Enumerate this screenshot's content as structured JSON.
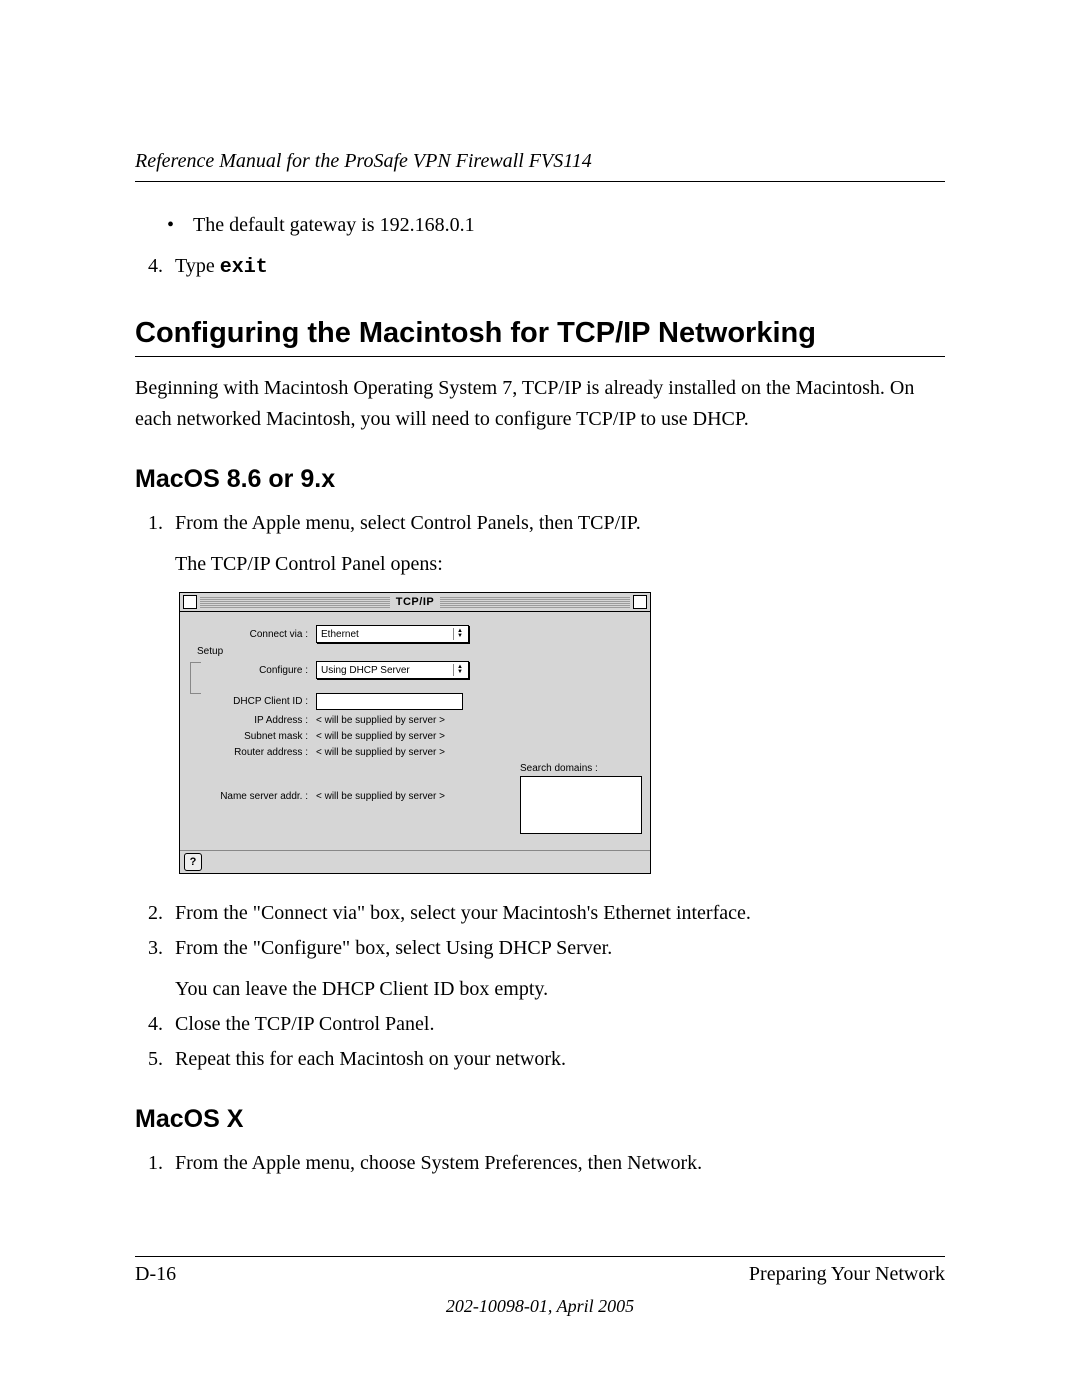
{
  "header": {
    "running_title": "Reference Manual for the ProSafe VPN Firewall FVS114"
  },
  "top_section": {
    "bullet_item": "The default gateway is 192.168.0.1",
    "step4_number": "4.",
    "step4_prefix": "Type ",
    "step4_command": "exit"
  },
  "section_heading": "Configuring the Macintosh for TCP/IP Networking",
  "intro_paragraph": "Beginning with Macintosh Operating System 7, TCP/IP is already installed on the Macintosh. On each networked Macintosh, you will need to configure TCP/IP to use DHCP.",
  "subsection_a": {
    "heading": "MacOS 8.6 or 9.x",
    "steps": {
      "s1_num": "1.",
      "s1_a": "From the Apple menu, select Control Panels, then TCP/IP.",
      "s1_b": "The TCP/IP Control Panel opens:",
      "s2_num": "2.",
      "s2": "From the \"Connect via\" box, select your Macintosh's Ethernet interface.",
      "s3_num": "3.",
      "s3_a": "From the \"Configure\" box, select Using DHCP Server.",
      "s3_b": "You can leave the DHCP Client ID box empty.",
      "s4_num": "4.",
      "s4": "Close the TCP/IP Control Panel.",
      "s5_num": "5.",
      "s5": "Repeat this for each Macintosh on your network."
    }
  },
  "tcpip_panel": {
    "title": "TCP/IP",
    "setup_label": "Setup",
    "labels": {
      "connect_via": "Connect via :",
      "configure": "Configure :",
      "dhcp_client_id": "DHCP Client ID :",
      "ip_address": "IP Address :",
      "subnet_mask": "Subnet mask :",
      "router_address": "Router address :",
      "name_server": "Name server addr. :",
      "search_domains": "Search domains :"
    },
    "values": {
      "connect_via": "Ethernet",
      "configure": "Using DHCP Server",
      "supplied": "< will be supplied by server >"
    },
    "help_glyph": "?"
  },
  "subsection_b": {
    "heading": "MacOS X",
    "s1_num": "1.",
    "s1": "From the Apple menu, choose System Preferences, then Network."
  },
  "footer": {
    "page_number": "D-16",
    "section_title": "Preparing Your Network",
    "doc_id": "202-10098-01, April 2005"
  }
}
